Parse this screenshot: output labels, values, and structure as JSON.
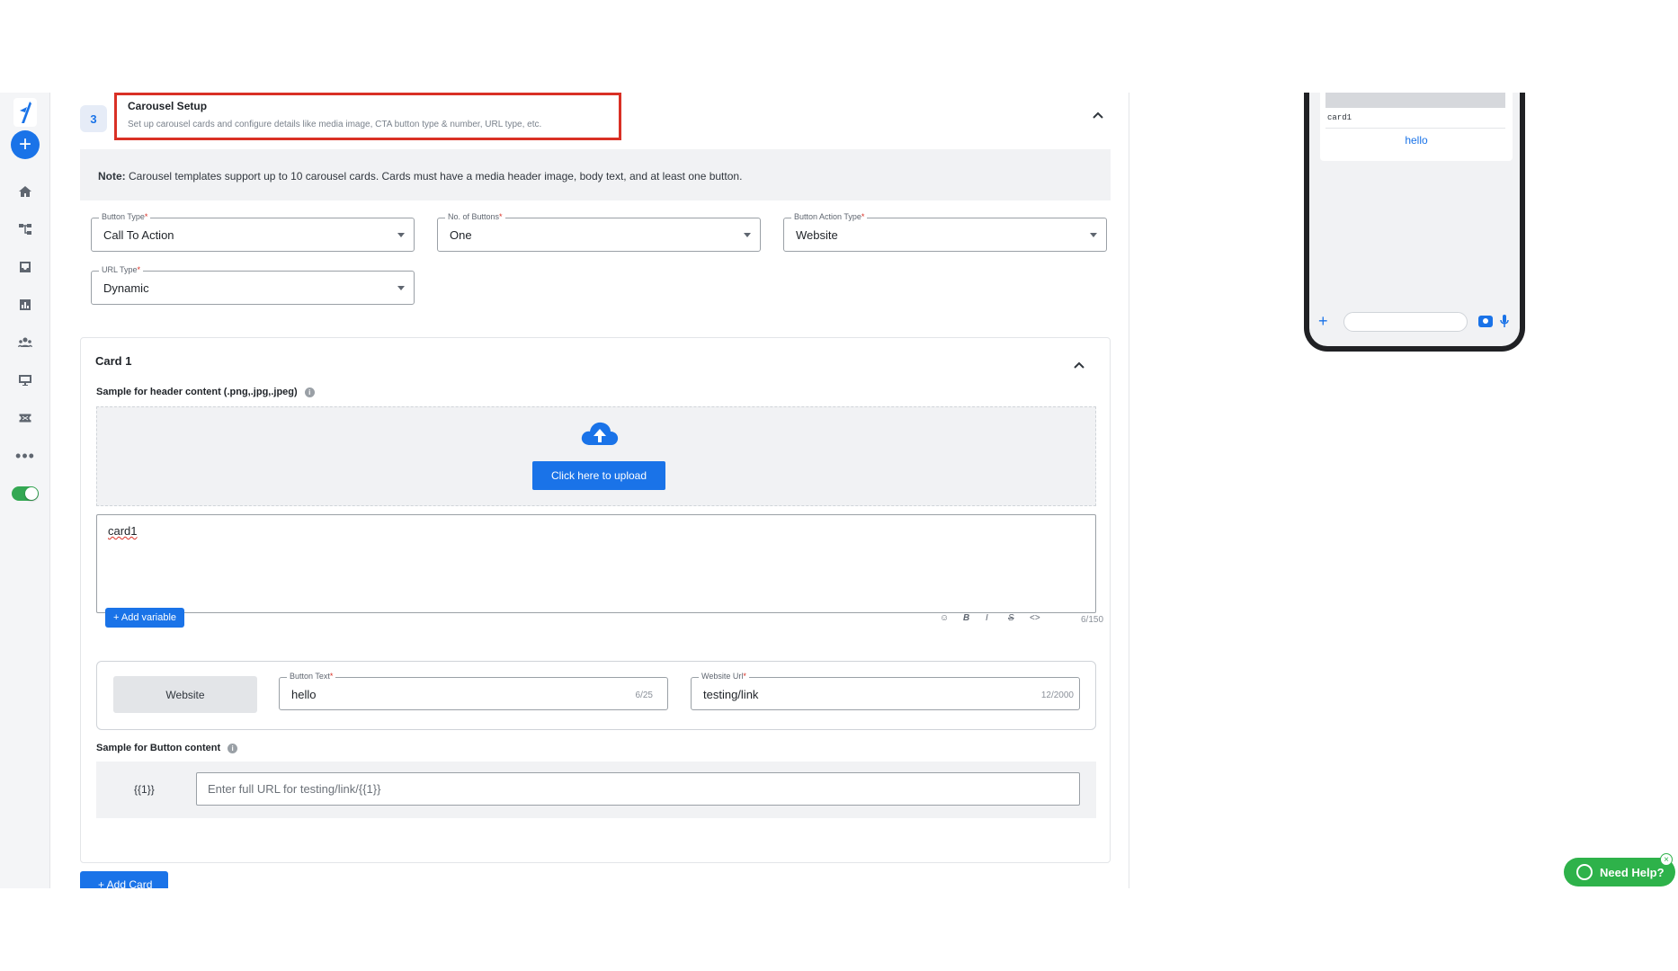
{
  "step": {
    "number": "3",
    "title": "Carousel Setup",
    "subtitle": "Set up carousel cards and configure details like media image, CTA button type & number, URL type, etc."
  },
  "note": {
    "label": "Note:",
    "text": " Carousel templates support up to 10 carousel cards. Cards must have a media header image, body text, and at least one button."
  },
  "fields": {
    "button_type": {
      "label": "Button Type",
      "required": "*",
      "value": "Call To Action"
    },
    "num_buttons": {
      "label": "No. of Buttons",
      "required": "*",
      "value": "One"
    },
    "button_action_type": {
      "label": "Button Action Type",
      "required": "*",
      "value": "Website"
    },
    "url_type": {
      "label": "URL Type",
      "required": "*",
      "value": "Dynamic"
    }
  },
  "card": {
    "title": "Card 1",
    "header_label": "Sample for header content (.png,.jpg,.jpeg)",
    "upload_label": "Click here to upload",
    "body_text": "card1",
    "add_variable": "+ Add variable",
    "format_tools": [
      "☺",
      "B",
      "I",
      "S",
      "<>"
    ],
    "body_count": "6/150",
    "button_kind": "Website",
    "button_text": {
      "label": "Button Text",
      "required": "*",
      "value": "hello",
      "count": "6/25"
    },
    "website_url": {
      "label": "Website Url",
      "required": "*",
      "value": "testing/link",
      "count": "12/2000"
    },
    "button_sample_label": "Sample for Button content",
    "variable_tag": "{{1}}",
    "url_placeholder": "Enter full URL for testing/link/{{1}}"
  },
  "add_card_label": "+ Add Card",
  "preview": {
    "body": "card1",
    "button": "hello"
  },
  "help": {
    "label": "Need Help?",
    "close": "×"
  },
  "colors": {
    "accent": "#1a73e8",
    "highlight_border": "#d93025",
    "whatsapp_green": "#2eb24a"
  }
}
